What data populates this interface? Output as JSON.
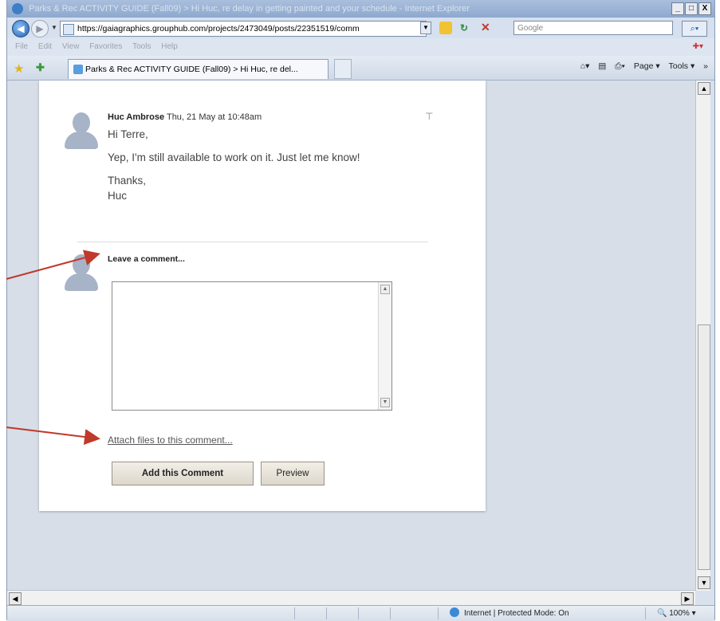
{
  "window": {
    "title": "Parks & Rec ACTIVITY GUIDE (Fall09) > Hi Huc, re delay in getting painted and your schedule - Internet Explorer",
    "buttons": [
      "_",
      "□",
      "X"
    ]
  },
  "address_bar": {
    "url": "https://gaiagraphics.grouphub.com/projects/2473049/posts/22351519/comm",
    "search_placeholder": "Google"
  },
  "menu": {
    "items": [
      "File",
      "Edit",
      "View",
      "Favorites",
      "Tools",
      "Help"
    ]
  },
  "tab": {
    "label": "Parks & Rec ACTIVITY GUIDE (Fall09) > Hi Huc, re del..."
  },
  "command_bar": {
    "items": [
      "Page ▾",
      "Tools ▾",
      "»"
    ]
  },
  "comment": {
    "author": "Huc Ambrose",
    "timestamp": "Thu, 21 May at 10:48am",
    "paragraphs": [
      "Hi Terre,",
      "Yep, I'm still available to work on it. Just let me know!",
      "Thanks,\nHuc"
    ]
  },
  "form": {
    "leave_label": "Leave a comment...",
    "attach_label": "Attach files to this comment...",
    "submit_label": "Add this Comment",
    "preview_label": "Preview"
  },
  "status": {
    "zone_text": "Internet | Protected Mode: On",
    "zoom_text": "100%"
  },
  "colors": {
    "annotation_arrow": "#c0392b",
    "accent": "#1f5fb5"
  },
  "icons": [
    "back-icon",
    "forward-icon",
    "lock-icon",
    "refresh-icon",
    "stop-icon",
    "search-icon",
    "favorites-star-icon",
    "add-favorites-icon",
    "page-icon",
    "pin-icon",
    "globe-icon"
  ]
}
